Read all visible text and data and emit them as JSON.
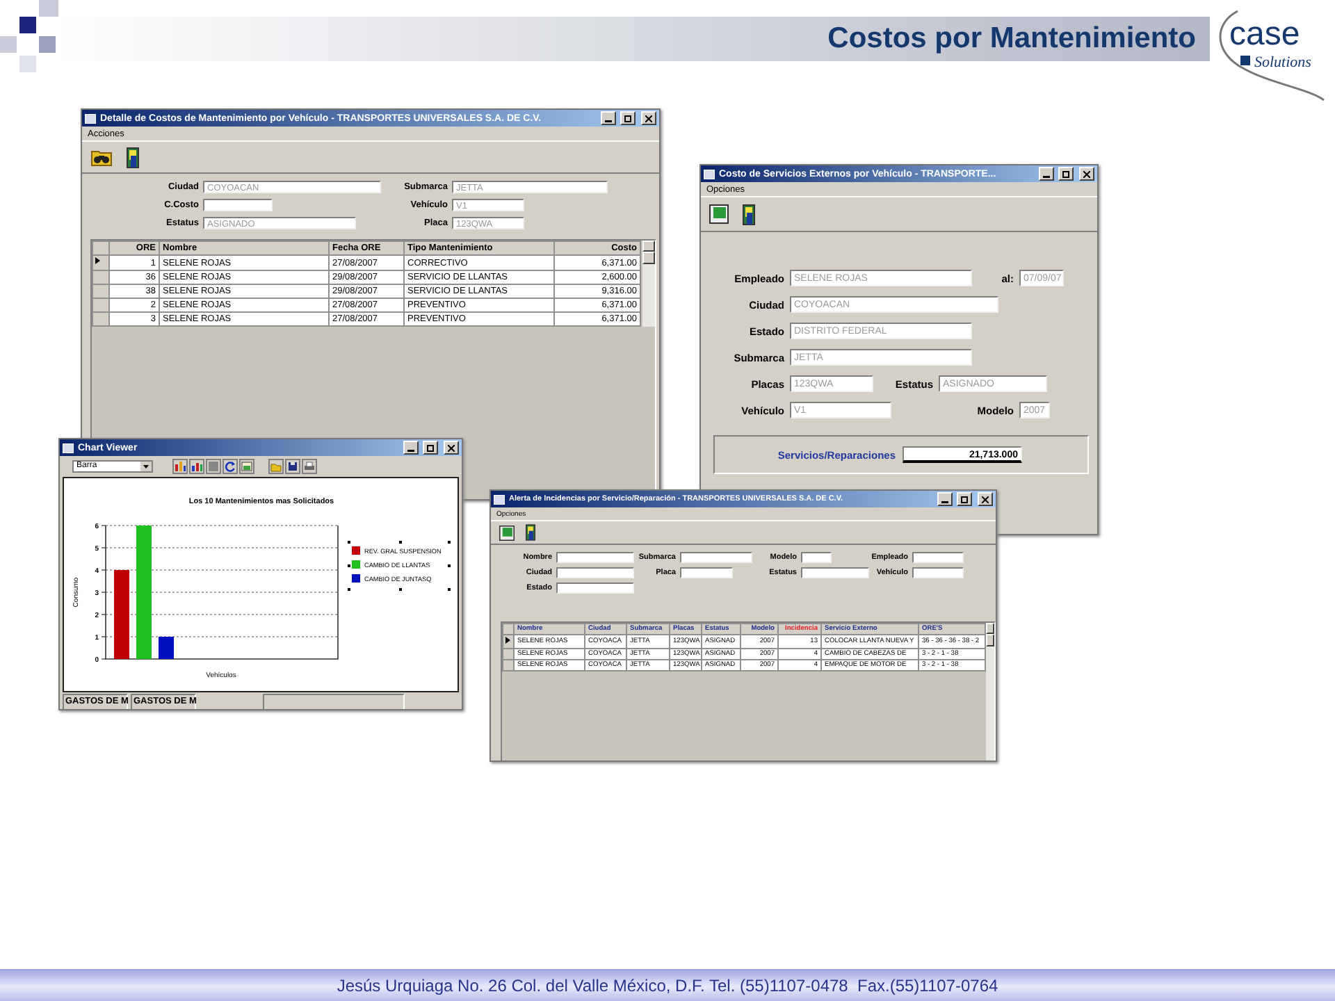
{
  "header": {
    "title": "Costos por Mantenimiento",
    "logo": {
      "name": "case",
      "tagline": "Solutions"
    }
  },
  "windows": [
    {
      "kind": "detail",
      "title": "Detalle de Costos de Mantenimiento por Vehículo - TRANSPORTES UNIVERSALES S.A. DE C.V.",
      "menu": [
        "Acciones"
      ],
      "fields": [
        {
          "label": "Ciudad",
          "value": "COYOACAN",
          "disabled": true
        },
        {
          "label": "Submarca",
          "value": "JETTA",
          "disabled": true
        },
        {
          "label": "C.Costo"
        },
        {
          "label": "Vehículo",
          "value": "V1",
          "disabled": true
        },
        {
          "label": "Estatus",
          "value": "ASIGNADO",
          "disabled": true
        },
        {
          "label": "Placa",
          "value": "123QWA",
          "disabled": true
        }
      ],
      "table": {
        "columns": [
          "ORE",
          "Nombre",
          "Fecha ORE",
          "Tipo Mantenimiento",
          "Costo"
        ],
        "rows": [
          {
            "selected": true,
            "cells": [
              "1",
              "SELENE ROJAS",
              "27/08/2007",
              "CORRECTIVO",
              "6,371.00"
            ]
          },
          {
            "selected": false,
            "cells": [
              "36",
              "SELENE ROJAS",
              "29/08/2007",
              "SERVICIO DE LLANTAS",
              "2,600.00"
            ]
          },
          {
            "selected": false,
            "cells": [
              "38",
              "SELENE ROJAS",
              "29/08/2007",
              "SERVICIO DE LLANTAS",
              "9,316.00"
            ]
          },
          {
            "selected": false,
            "cells": [
              "2",
              "SELENE ROJAS",
              "27/08/2007",
              "PREVENTIVO",
              "6,371.00"
            ]
          },
          {
            "selected": false,
            "cells": [
              "3",
              "SELENE ROJAS",
              "27/08/2007",
              "PREVENTIVO",
              "6,371.00"
            ]
          }
        ]
      }
    },
    {
      "kind": "services",
      "title": "Costo de Servicios Externos por Vehículo - TRANSPORTE...",
      "menu": [
        "Opciones"
      ],
      "rows": [
        [
          {
            "label": "Empleado",
            "value": "SELENE ROJAS",
            "disabled": true
          },
          {
            "label": "al:",
            "value": "07/09/07",
            "disabled": true
          }
        ],
        [
          {
            "label": "Ciudad",
            "value": "COYOACAN",
            "disabled": true
          }
        ],
        [
          {
            "label": "Estado",
            "value": "DISTRITO FEDERAL",
            "disabled": true
          }
        ],
        [
          {
            "label": "Submarca",
            "value": "JETTA",
            "disabled": true
          }
        ],
        [
          {
            "label": "Placas",
            "value": "123QWA",
            "disabled": true
          },
          {
            "label": "Estatus",
            "value": "ASIGNADO",
            "disabled": true
          }
        ],
        [
          {
            "label": "Vehículo",
            "value": "V1",
            "disabled": true
          },
          {
            "label": "Modelo",
            "value": "2007",
            "disabled": true
          }
        ]
      ],
      "total": {
        "label": "Servicios/Reparaciones",
        "value": "21,713.000"
      }
    },
    {
      "kind": "chart",
      "title": "Chart Viewer",
      "combo": {
        "value": "Barra"
      },
      "chart_data": {
        "type": "bar",
        "title": "Los 10 Mantenimientos mas Solicitados",
        "xlabel": "Vehículos",
        "ylabel": "Consumo",
        "ylim": [
          0,
          6
        ],
        "yticks": [
          0,
          1,
          2,
          3,
          4,
          5,
          6
        ],
        "grid": true,
        "legend": true,
        "series": [
          {
            "name": "REV. GRAL SUSPENSION",
            "color": "#c00000",
            "values": [
              4
            ]
          },
          {
            "name": "CAMBIO DE LLANTAS",
            "color": "#20c020",
            "values": [
              6
            ]
          },
          {
            "name": "CAMBIO DE JUNTASQ",
            "color": "#0010c0",
            "values": [
              1
            ]
          }
        ]
      },
      "status": [
        "GASTOS DE M",
        "GASTOS DE M"
      ]
    },
    {
      "kind": "alert",
      "title": "Alerta de Incidencias por Servicio/Reparación - TRANSPORTES UNIVERSALES S.A. DE C.V.",
      "menu": [
        "Opciones"
      ],
      "rows": [
        [
          {
            "label": "Nombre"
          },
          {
            "label": "Submarca"
          },
          {
            "label": "Modelo"
          },
          {
            "label": "Empleado"
          }
        ],
        [
          {
            "label": "Ciudad"
          },
          {
            "label": "Placa"
          },
          {
            "label": "Estatus"
          },
          {
            "label": "Vehículo"
          }
        ],
        [
          {
            "label": "Estado"
          }
        ]
      ],
      "table": {
        "columns": [
          {
            "label": "Nombre",
            "highlighted": false
          },
          {
            "label": "Ciudad",
            "highlighted": false
          },
          {
            "label": "Submarca",
            "highlighted": false
          },
          {
            "label": "Placas",
            "highlighted": false
          },
          {
            "label": "Estatus",
            "highlighted": false
          },
          {
            "label": "Modelo",
            "highlighted": false
          },
          {
            "label": "Incidencia",
            "highlighted": true
          },
          {
            "label": "Servicio Externo",
            "highlighted": false
          },
          {
            "label": "ORE'S",
            "highlighted": false
          }
        ],
        "rows": [
          {
            "selected": true,
            "cells": [
              "SELENE ROJAS",
              "COYOACA",
              "JETTA",
              "123QWA",
              "ASIGNAD",
              "2007",
              "13",
              "COLOCAR LLANTA NUEVA Y",
              "36 - 36 - 36 - 38 - 2"
            ]
          },
          {
            "selected": false,
            "cells": [
              "SELENE ROJAS",
              "COYOACA",
              "JETTA",
              "123QWA",
              "ASIGNAD",
              "2007",
              "4",
              "CAMBIO DE CABEZAS DE",
              "3 - 2 - 1 - 38"
            ]
          },
          {
            "selected": false,
            "cells": [
              "SELENE ROJAS",
              "COYOACA",
              "JETTA",
              "123QWA",
              "ASIGNAD",
              "2007",
              "4",
              "EMPAQUE DE MOTOR DE",
              "3 - 2 - 1 - 38"
            ]
          }
        ]
      }
    }
  ],
  "footer": "Jesús Urquiaga No. 26 Col. del Valle México, D.F. Tel. (55)1107-0478  Fax.(55)1107-0764"
}
